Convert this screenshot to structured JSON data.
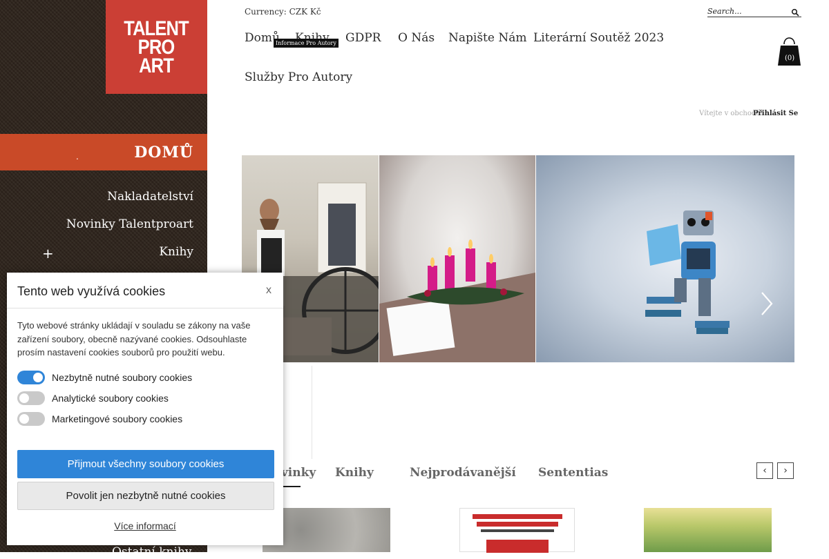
{
  "logo": {
    "line1": "TALENT",
    "line2": "PRO",
    "line3": "ART"
  },
  "sidebar": {
    "active": {
      "dot": ".",
      "label": "DOMŮ"
    },
    "items": [
      {
        "label": "Nakladatelství"
      },
      {
        "label": "Novinky Talentproart"
      },
      {
        "label": "Knihy"
      }
    ],
    "expand": "+",
    "bottom_partial": "Ostatní knihy"
  },
  "header": {
    "currency": "Currency: CZK Kč",
    "search_placeholder": "Search...",
    "nav": [
      {
        "label": "Domů"
      },
      {
        "label": "Knihy"
      },
      {
        "label": "GDPR"
      },
      {
        "label": "O Nás"
      },
      {
        "label": "Napište Nám"
      },
      {
        "label": "Literární Soutěž 2023"
      },
      {
        "label": "Služby Pro Autory"
      }
    ],
    "tooltip": "Informace Pro Autory",
    "cart_count": "(0)",
    "welcome": "Vítejte v obchodě!",
    "login": "Přihlásit Se"
  },
  "tabs": {
    "items": [
      {
        "label": "Novinky"
      },
      {
        "label": "Knihy"
      },
      {
        "label": "Nejprodávanější"
      },
      {
        "label": "Sententias"
      }
    ],
    "prev": "‹",
    "next": "›"
  },
  "cookie": {
    "title": "Tento web využívá cookies",
    "close": "x",
    "text": "Tyto webové stránky ukládají v souladu se zákony na vaše zařízení soubory, obecně nazývané cookies. Odsouhlaste prosím nastavení cookies souborů pro použití webu.",
    "toggles": [
      {
        "label": "Nezbytně nutné soubory cookies",
        "on": true
      },
      {
        "label": "Analytické soubory cookies",
        "on": false
      },
      {
        "label": "Marketingové soubory cookies",
        "on": false
      }
    ],
    "accept_all": "Přijmout všechny soubory cookies",
    "accept_necessary": "Povolit jen nezbytně nutné cookies",
    "more": "Více informací"
  },
  "colors": {
    "logo_bg": "#cb3f35",
    "nav_active": "#c94a28",
    "cookie_primary": "#2f85d8",
    "sidebar_bg": "#2e241c"
  }
}
